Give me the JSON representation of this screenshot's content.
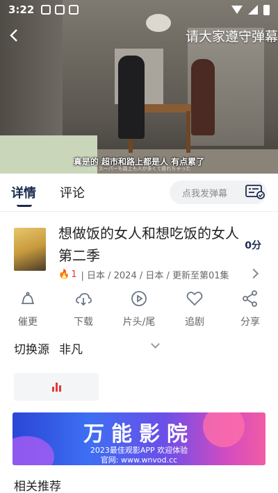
{
  "status_bar": {
    "time": "3:22"
  },
  "video": {
    "banner": "请大家遵守弹幕",
    "subtitle": "真是的 超市和路上都是人 有点累了",
    "subtitle_jp": "もう スーパーも路上も人が多くて疲れちゃった"
  },
  "tabs": [
    {
      "label": "详情",
      "active": true
    },
    {
      "label": "评论",
      "active": false
    }
  ],
  "danmu": {
    "placeholder": "点我发弹幕"
  },
  "show": {
    "title": "想做饭的女人和想吃饭的女人第二季",
    "hot_count": "1",
    "meta": "| 日本 / 2024 / 日本 / 更新至第01集",
    "score": "0分"
  },
  "actions": [
    {
      "label": "催更",
      "icon": "bell-icon"
    },
    {
      "label": "下载",
      "icon": "cloud-download-icon"
    },
    {
      "label": "片头/尾",
      "icon": "play-circle-icon"
    },
    {
      "label": "追剧",
      "icon": "heart-icon"
    },
    {
      "label": "分享",
      "icon": "share-icon"
    }
  ],
  "source": {
    "label": "切换源",
    "name": "非凡"
  },
  "ad": {
    "brand": "万能影院",
    "line1": "2023最佳观影APP 欢迎体验",
    "line2": "官网: www.wnvod.cc"
  },
  "related": {
    "label": "相关推荐"
  },
  "colors": {
    "accent": "#1b2a4e",
    "hot": "#e53935"
  }
}
